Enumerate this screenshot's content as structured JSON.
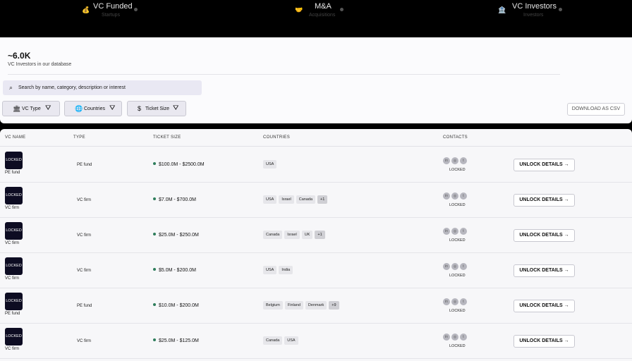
{
  "top_tabs": [
    {
      "emoji": "💰",
      "title": "VC Funded",
      "subtitle": "Startups"
    },
    {
      "emoji": "🤝",
      "title": "M&A",
      "subtitle": "Acquisitions"
    },
    {
      "emoji": "🏦",
      "title": "VC Investors",
      "subtitle": "Investors"
    }
  ],
  "summary": {
    "count": "~6.0K",
    "caption": "VC Investors in our database"
  },
  "search": {
    "placeholder": "Search by name, category, description or interest"
  },
  "filters": [
    {
      "icon": "🏛",
      "label": "VC Type"
    },
    {
      "icon": "🌐",
      "label": "Countries"
    },
    {
      "icon": "$",
      "label": "Ticket Size"
    }
  ],
  "download_label": "DOWNLOAD AS CSV",
  "columns": {
    "name": "VC NAME",
    "type": "TYPE",
    "ticket": "TICKET SIZE",
    "countries": "COUNTRIES",
    "contacts": "CONTACTS"
  },
  "rows": [
    {
      "logo": "LOCKED",
      "logo_sub": "PE fund",
      "type": "PE fund",
      "ticket": "$100.0M - $2500.0M",
      "countries": [
        "USA"
      ],
      "more": "",
      "contact_status": "LOCKED",
      "action": "UNLOCK DETAILS →"
    },
    {
      "logo": "LOCKED",
      "logo_sub": "VC firm",
      "type": "VC firm",
      "ticket": "$7.0M - $700.0M",
      "countries": [
        "USA",
        "Israel",
        "Canada"
      ],
      "more": "+1",
      "contact_status": "LOCKED",
      "action": "UNLOCK DETAILS →"
    },
    {
      "logo": "LOCKED",
      "logo_sub": "VC firm",
      "type": "VC firm",
      "ticket": "$25.0M - $250.0M",
      "countries": [
        "Canada",
        "Israel",
        "UK"
      ],
      "more": "+1",
      "contact_status": "LOCKED",
      "action": "UNLOCK DETAILS →"
    },
    {
      "logo": "LOCKED",
      "logo_sub": "VC firm",
      "type": "VC firm",
      "ticket": "$5.0M - $200.0M",
      "countries": [
        "USA",
        "India"
      ],
      "more": "",
      "contact_status": "LOCKED",
      "action": "UNLOCK DETAILS →"
    },
    {
      "logo": "LOCKED",
      "logo_sub": "PE fund",
      "type": "PE fund",
      "ticket": "$10.0M - $200.0M",
      "countries": [
        "Belgium",
        "Finland",
        "Denmark"
      ],
      "more": "+9",
      "contact_status": "LOCKED",
      "action": "UNLOCK DETAILS →"
    },
    {
      "logo": "LOCKED",
      "logo_sub": "VC firm",
      "type": "VC firm",
      "ticket": "$25.0M - $125.0M",
      "countries": [
        "Canada",
        "USA"
      ],
      "more": "",
      "contact_status": "LOCKED",
      "action": "UNLOCK DETAILS →"
    }
  ],
  "social_icons": [
    "linkedin-icon",
    "website-icon",
    "twitter-icon"
  ]
}
